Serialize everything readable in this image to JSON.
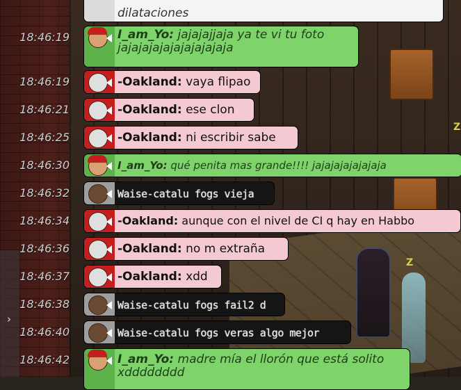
{
  "chat": {
    "messages": [
      {
        "time": "",
        "user": "",
        "text": "dilataciones",
        "style": "white",
        "partial": true
      },
      {
        "time": "18:46:19",
        "user": "I_am_Yo:",
        "text": "jajajajjaja ya te vi tu foto",
        "text2": "jajajajajajajajajajaja",
        "style": "green"
      },
      {
        "time": "18:46:19",
        "user": "-Oakland:",
        "text": "vaya flipao",
        "style": "pink"
      },
      {
        "time": "18:46:21",
        "user": "-Oakland:",
        "text": "ese clon",
        "style": "pink"
      },
      {
        "time": "18:46:25",
        "user": "-Oakland:",
        "text": "ni escribir sabe",
        "style": "pink"
      },
      {
        "time": "18:46:30",
        "user": "I_am_Yo:",
        "text": "qué penita mas grande!!!! jajajajajajajaja",
        "style": "green"
      },
      {
        "time": "18:46:32",
        "user": "",
        "text": "Waise-catalu fogs vieja",
        "style": "dark"
      },
      {
        "time": "18:46:34",
        "user": "-Oakland:",
        "text": "aunque con el nivel de CI q hay en Habbo",
        "style": "pink"
      },
      {
        "time": "18:46:36",
        "user": "-Oakland:",
        "text": "no m extraña",
        "style": "pink"
      },
      {
        "time": "18:46:37",
        "user": "-Oakland:",
        "text": "xdd",
        "style": "pink"
      },
      {
        "time": "18:46:38",
        "user": "",
        "text": "Waise-catalu fogs fail2 d",
        "style": "dark"
      },
      {
        "time": "18:46:40",
        "user": "",
        "text": "Waise-catalu fogs veras algo mejor",
        "style": "dark"
      },
      {
        "time": "18:46:42",
        "user": "I_am_Yo:",
        "text": "madre mía el llorón que está solito",
        "text2": "xdddddddd",
        "style": "green"
      }
    ]
  },
  "room": {
    "z_markers": [
      "Z",
      "Z"
    ]
  },
  "side_tab": {
    "arrow_icon": "chevron-right-icon",
    "arrow": "›"
  },
  "colors": {
    "green_bubble": "#7ed36b",
    "pink_bubble": "#f4c9d2",
    "dark_bubble": "#151515",
    "timestamp": "#cfcfcf"
  }
}
